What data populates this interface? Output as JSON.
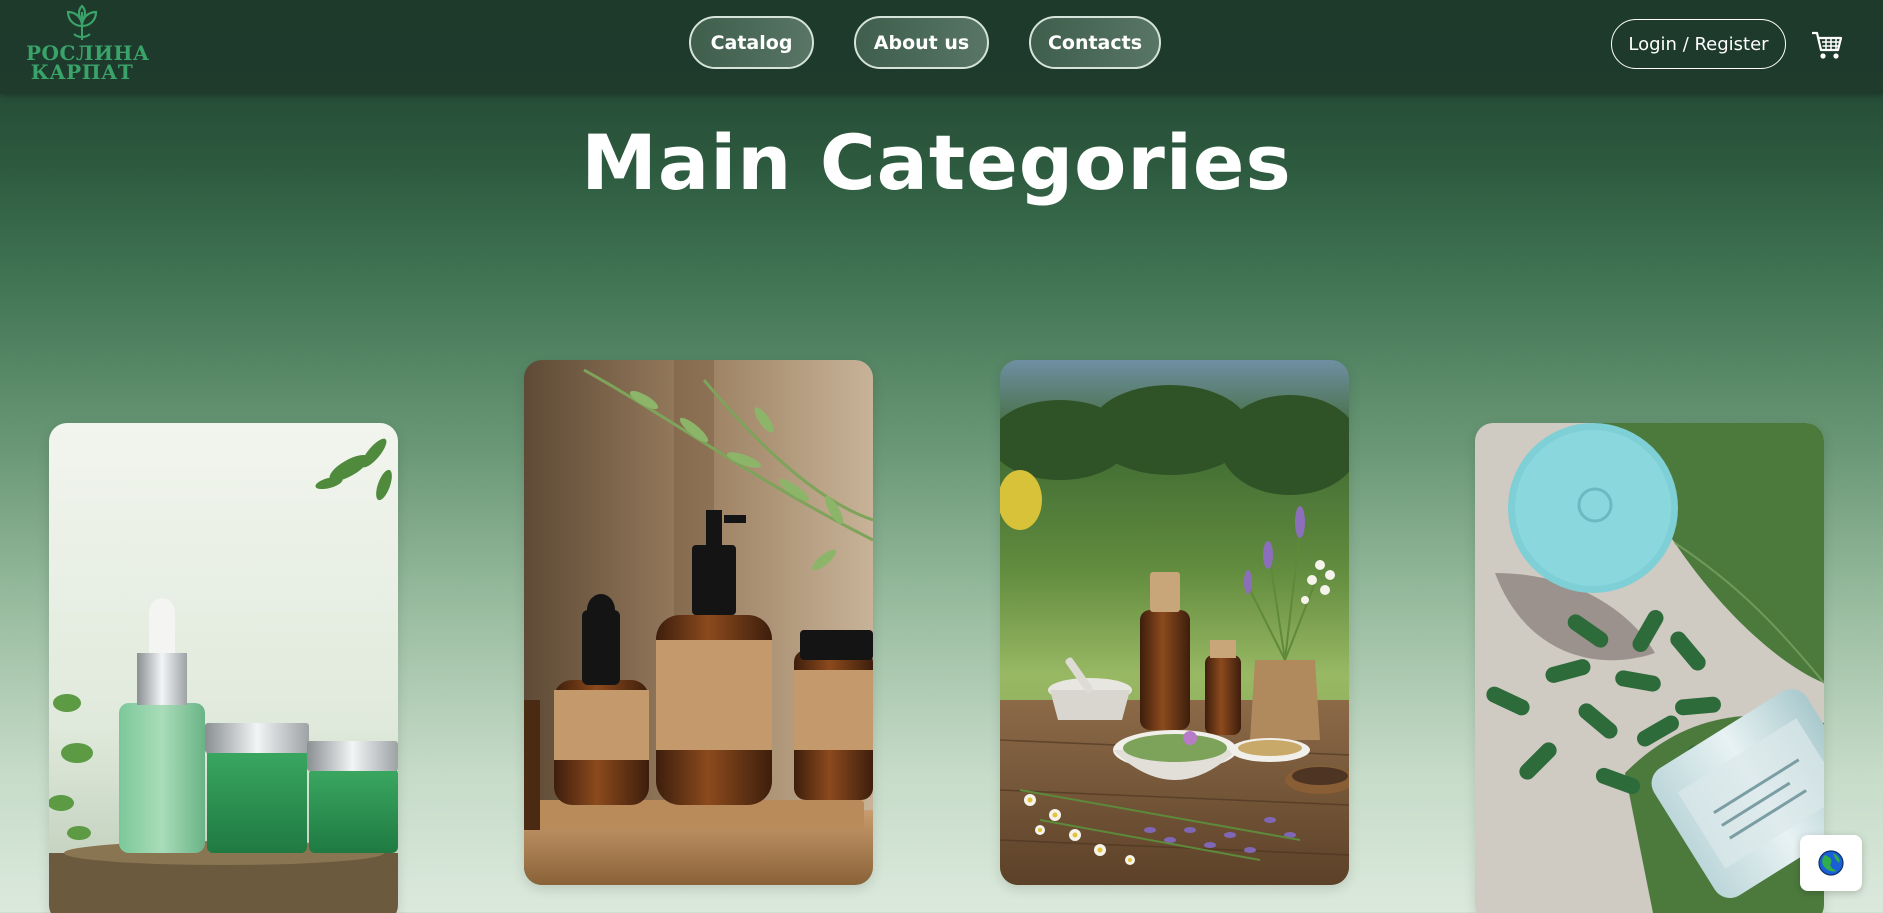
{
  "header": {
    "logo": {
      "line1": "РОСЛИНА",
      "line2": "КАРПАТ",
      "icon": "leaf-icon"
    },
    "nav": [
      {
        "label": "Catalog"
      },
      {
        "label": "About us"
      },
      {
        "label": "Contacts"
      }
    ],
    "login_label": "Login / Register",
    "cart_icon": "cart-icon"
  },
  "main": {
    "title": "Main Categories",
    "categories": [
      {
        "image": "green-cosmetic-bottles-photo"
      },
      {
        "image": "amber-dropper-bottles-photo"
      },
      {
        "image": "herbal-remedies-table-photo"
      },
      {
        "image": "green-capsules-jar-photo"
      }
    ]
  },
  "language_widget": {
    "icon": "globe-icon"
  },
  "colors": {
    "header_bg": "#1e3a2b",
    "logo_green": "#3aa36a",
    "title_white": "#ffffff",
    "page_gradient_top": "#1e3d2d",
    "page_gradient_bottom": "#dbe9dc"
  }
}
